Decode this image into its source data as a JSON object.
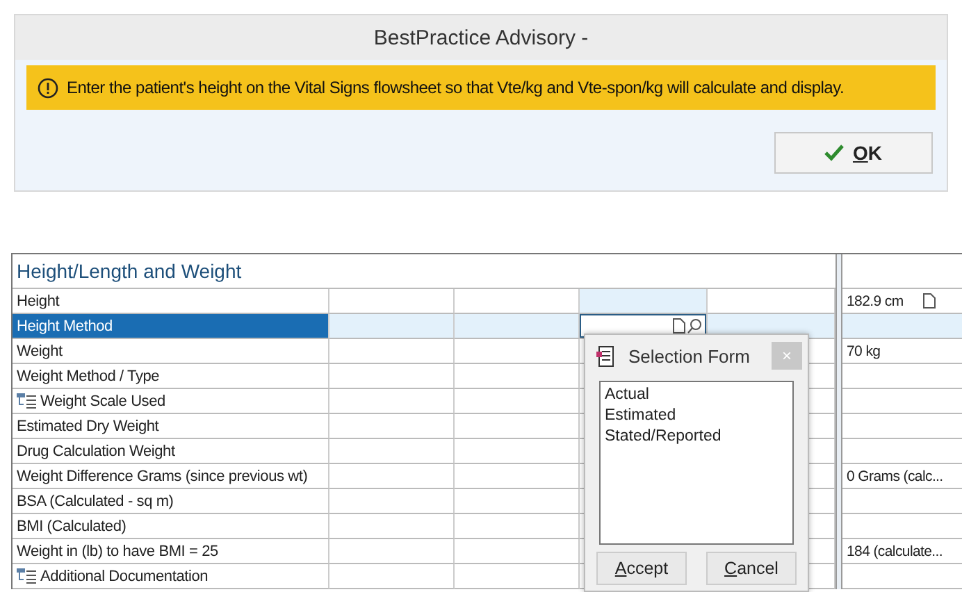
{
  "advisory": {
    "title": "BestPractice Advisory -",
    "message": "Enter the patient's height on the Vital Signs flowsheet so that Vte/kg and Vte-spon/kg will calculate and display.",
    "ok_button": "OK"
  },
  "flowsheet": {
    "section": "Height/Length and Weight",
    "rows": [
      {
        "label": "Height",
        "kind": "item",
        "selected": false,
        "result": "182.9 cm",
        "has_note": true
      },
      {
        "label": "Height Method",
        "kind": "item",
        "selected": true
      },
      {
        "label": "Weight",
        "kind": "item",
        "selected": false,
        "result": "70 kg"
      },
      {
        "label": "Weight Method / Type",
        "kind": "item",
        "selected": false
      },
      {
        "label": "Weight Scale Used",
        "kind": "group",
        "selected": false
      },
      {
        "label": "Estimated Dry Weight",
        "kind": "item",
        "selected": false
      },
      {
        "label": "Drug Calculation Weight",
        "kind": "item",
        "selected": false
      },
      {
        "label": "Weight Difference Grams (since previous wt)",
        "kind": "item",
        "selected": false,
        "result": "0 Grams (calc..."
      },
      {
        "label": "BSA (Calculated - sq m)",
        "kind": "item",
        "selected": false
      },
      {
        "label": "BMI (Calculated)",
        "kind": "item",
        "selected": false
      },
      {
        "label": "Weight in (lb) to have BMI = 25",
        "kind": "item",
        "selected": false,
        "result": "184 (calculate..."
      },
      {
        "label": "Additional Documentation",
        "kind": "group",
        "selected": false
      }
    ]
  },
  "selection_form": {
    "title": "Selection Form",
    "close": "×",
    "options": [
      "Actual",
      "Estimated",
      "Stated/Reported"
    ],
    "buttons": [
      "Accept",
      "Cancel"
    ]
  }
}
